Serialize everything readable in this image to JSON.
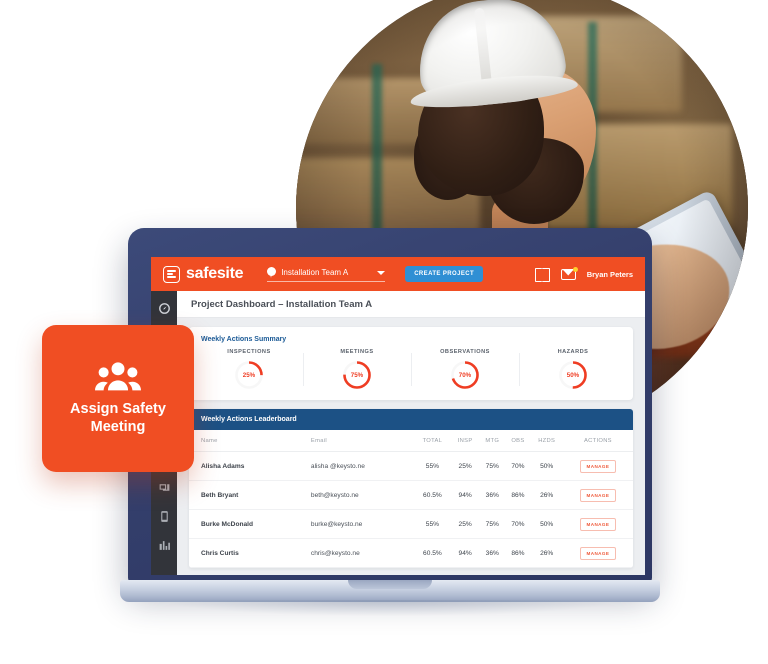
{
  "app": {
    "brand": "safesite",
    "brand_color": "#f04e23",
    "topbar": {
      "project_selector_value": "Installation Team A",
      "create_button": "CREATE PROJECT",
      "create_button_color": "#2f8fd4",
      "user_name": "Bryan Peters",
      "icons": [
        "book-icon",
        "mail-icon"
      ]
    },
    "sidebar": {
      "items": [
        {
          "name": "dashboard",
          "icon": "gauge-icon",
          "active": true
        },
        {
          "name": "safety",
          "icon": "cone-icon",
          "active": false
        },
        {
          "name": "reports",
          "icon": "clipboard-icon",
          "active": false
        },
        {
          "name": "photos",
          "icon": "photo-icon",
          "active": false
        },
        {
          "name": "mobile",
          "icon": "phone-icon",
          "active": false
        },
        {
          "name": "analytics",
          "icon": "chart-building-icon",
          "active": false
        }
      ]
    },
    "page_title": "Project Dashboard – Installation Team A",
    "summary": {
      "heading": "Weekly Actions Summary",
      "heading_color": "#1b5a96"
    },
    "leaderboard": {
      "heading": "Weekly Actions Leaderboard",
      "heading_bg": "#1c5185",
      "columns": [
        "Name",
        "Email",
        "TOTAL",
        "INSP",
        "MTG",
        "OBS",
        "HZDS",
        "ACTIONS"
      ],
      "action_label": "MANAGE",
      "rows": [
        {
          "name": "Alisha Adams",
          "email": "alisha @keysto.ne",
          "total": "55%",
          "insp": "25%",
          "mtg": "75%",
          "obs": "70%",
          "hzds": "50%"
        },
        {
          "name": "Beth Bryant",
          "email": "beth@keysto.ne",
          "total": "60.5%",
          "insp": "94%",
          "mtg": "36%",
          "obs": "86%",
          "hzds": "26%"
        },
        {
          "name": "Burke McDonald",
          "email": "burke@keysto.ne",
          "total": "55%",
          "insp": "25%",
          "mtg": "75%",
          "obs": "70%",
          "hzds": "50%"
        },
        {
          "name": "Chris Curtis",
          "email": "chris@keysto.ne",
          "total": "60.5%",
          "insp": "94%",
          "mtg": "36%",
          "obs": "86%",
          "hzds": "26%"
        }
      ]
    }
  },
  "badge": {
    "line1": "Assign Safety",
    "line2": "Meeting",
    "icon": "people-group-icon",
    "background": "#f04e23"
  },
  "chart_data": {
    "type": "pie",
    "title": "Weekly Actions Summary",
    "subtitle": "",
    "categories": [
      "INSPECTIONS",
      "MEETINGS",
      "OBSERVATIONS",
      "HAZARDS"
    ],
    "values": [
      25,
      75,
      70,
      50
    ],
    "value_labels": [
      "25%",
      "75%",
      "70%",
      "50%"
    ],
    "unit": "%",
    "ylim": [
      0,
      100
    ],
    "arc_color": "#ef3d23",
    "track_color": "#f7f7f7",
    "legend": "none",
    "grid": false
  }
}
